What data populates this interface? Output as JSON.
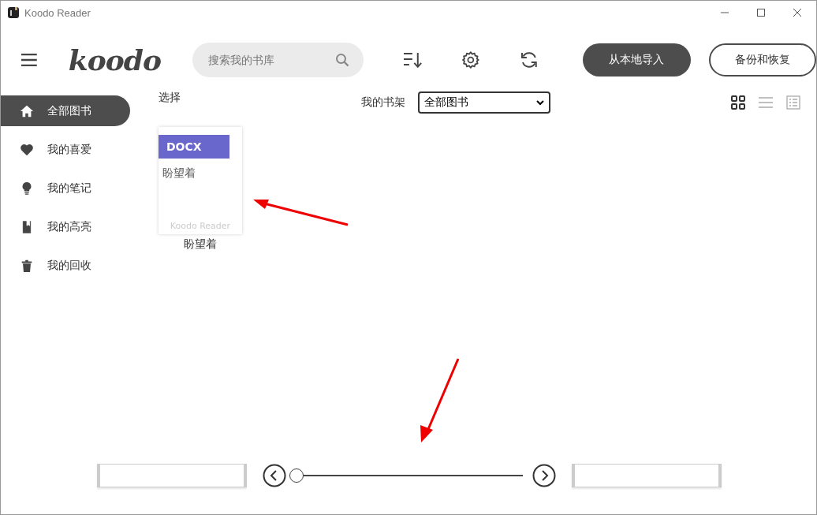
{
  "window": {
    "title": "Koodo Reader"
  },
  "header": {
    "logo": "koodo",
    "search": {
      "placeholder": "搜索我的书库"
    },
    "buttons": [
      {
        "label": "从本地导入",
        "kind": "primary"
      },
      {
        "label": "备份和恢复",
        "kind": "outline"
      }
    ]
  },
  "sidebar": {
    "items": [
      {
        "label": "全部图书",
        "kind": "home",
        "selected": true
      },
      {
        "label": "我的喜爱",
        "kind": "heart",
        "selected": false
      },
      {
        "label": "我的笔记",
        "kind": "bulb",
        "selected": false
      },
      {
        "label": "我的高亮",
        "kind": "book",
        "selected": false
      },
      {
        "label": "我的回收",
        "kind": "trash",
        "selected": false
      }
    ]
  },
  "toolbar": {
    "select": "选择",
    "shelf_label": "我的书架",
    "shelf_value": "全部图书",
    "views": [
      {
        "kind": "grid",
        "selected": true
      },
      {
        "kind": "list",
        "selected": false
      },
      {
        "kind": "table",
        "selected": false
      }
    ]
  },
  "books": [
    {
      "format": "DOCX",
      "cover_title": "盼望着",
      "cover_brand": "Koodo Reader",
      "title": "盼望着"
    }
  ],
  "pager": {
    "level": 0
  }
}
